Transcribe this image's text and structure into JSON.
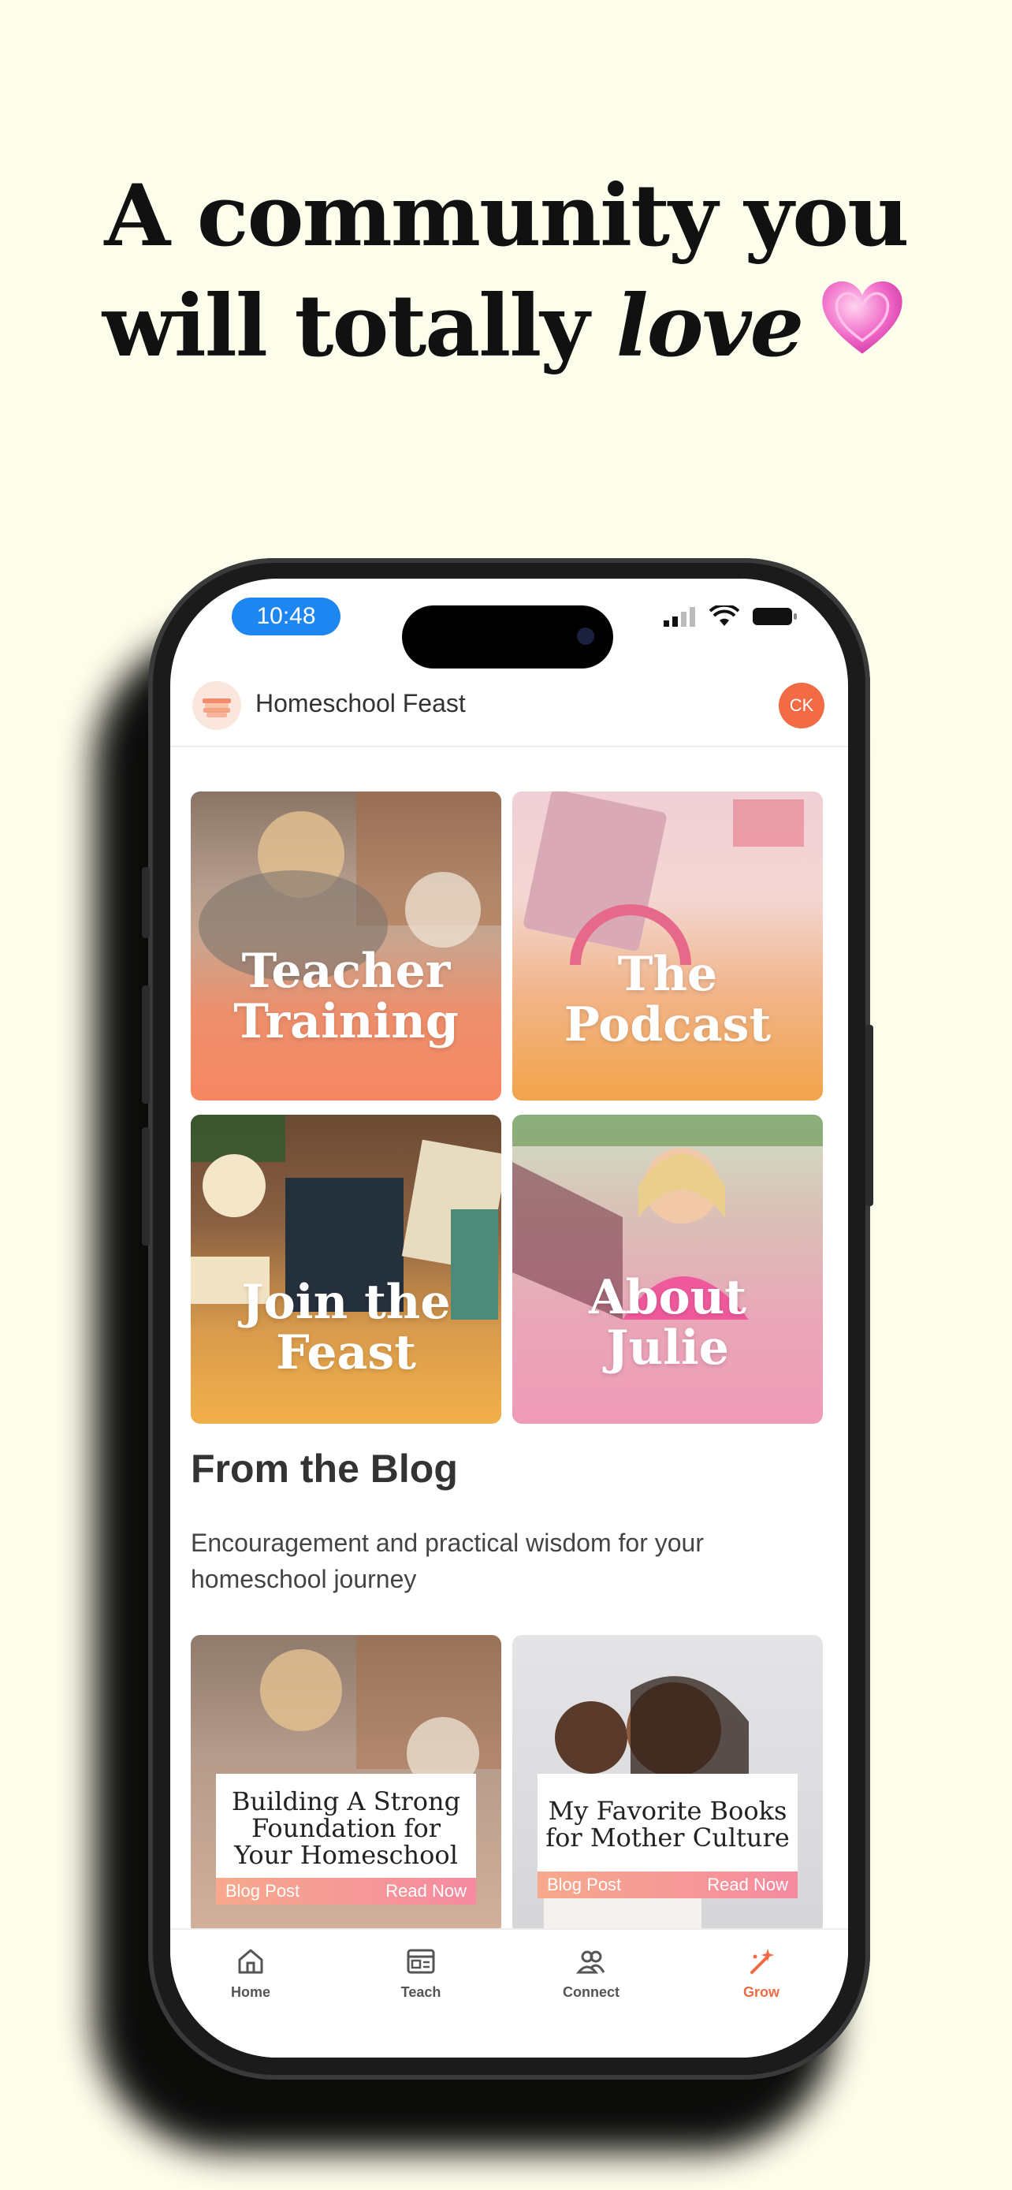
{
  "headline": {
    "line1": "A community you",
    "line2_prefix": "will totally ",
    "line2_emph": "love"
  },
  "status": {
    "time": "10:48"
  },
  "app": {
    "title": "Homeschool Feast",
    "avatar": "CK"
  },
  "tiles": [
    {
      "label_line1": "Teacher",
      "label_line2": "Training"
    },
    {
      "label_line1": "The",
      "label_line2": "Podcast"
    },
    {
      "label_line1": "Join the",
      "label_line2": "Feast"
    },
    {
      "label_line1": "About",
      "label_line2": "Julie"
    }
  ],
  "blog": {
    "heading": "From the Blog",
    "subtitle": "Encouragement and practical wisdom for your homeschool journey",
    "posts": [
      {
        "title": "Building A Strong Foundation for Your Homeschool",
        "tag": "Blog Post",
        "cta": "Read Now"
      },
      {
        "title": "My Favorite Books for Mother Culture",
        "tag": "Blog Post",
        "cta": "Read Now"
      }
    ]
  },
  "tabs": [
    {
      "label": "Home",
      "icon": "home-icon"
    },
    {
      "label": "Teach",
      "icon": "teach-icon"
    },
    {
      "label": "Connect",
      "icon": "connect-icon"
    },
    {
      "label": "Grow",
      "icon": "grow-icon",
      "active": true
    }
  ],
  "colors": {
    "accent": "#f26b45",
    "background": "#fdfdeb",
    "status_pill": "#1e86f0"
  }
}
